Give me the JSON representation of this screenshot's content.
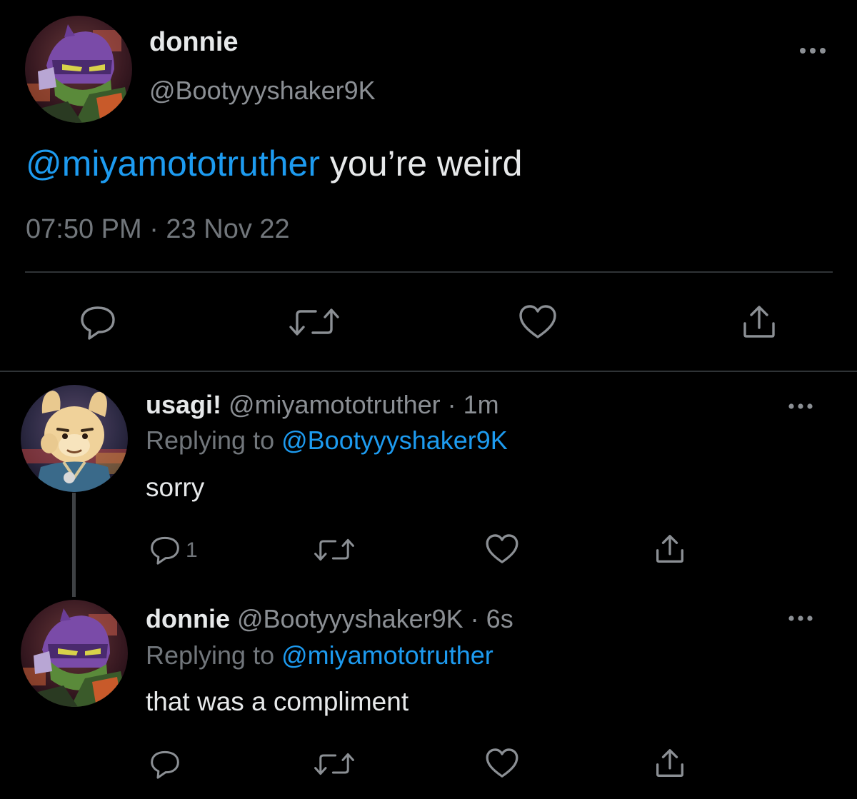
{
  "main_tweet": {
    "avatar_icon": "donnie-avatar-icon",
    "display_name": "donnie",
    "handle": "@Bootyyyshaker9K",
    "mention": "@miyamototruther",
    "text": " you’re weird",
    "timestamp": "07:50 PM · 23 Nov 22",
    "actions": [
      "reply-icon",
      "retweet-icon",
      "like-icon",
      "share-icon"
    ]
  },
  "replies": [
    {
      "avatar_icon": "usagi-avatar-icon",
      "display_name": "usagi!",
      "handle_time": " @miyamototruther · 1m",
      "replying_prefix": "Replying to ",
      "replying_handle": "@Bootyyyshaker9K",
      "text": "sorry",
      "reply_count": "1"
    },
    {
      "avatar_icon": "donnie-avatar-icon",
      "display_name": "donnie",
      "handle_time": " @Bootyyyshaker9K · 6s",
      "replying_prefix": "Replying to ",
      "replying_handle": "@miyamototruther",
      "text": "that was a compliment",
      "reply_count": ""
    }
  ],
  "colors": {
    "background": "#000000",
    "accent": "#1d9bf0",
    "text": "#e7e9ea",
    "muted": "#71767b",
    "divider": "#2f3336"
  }
}
